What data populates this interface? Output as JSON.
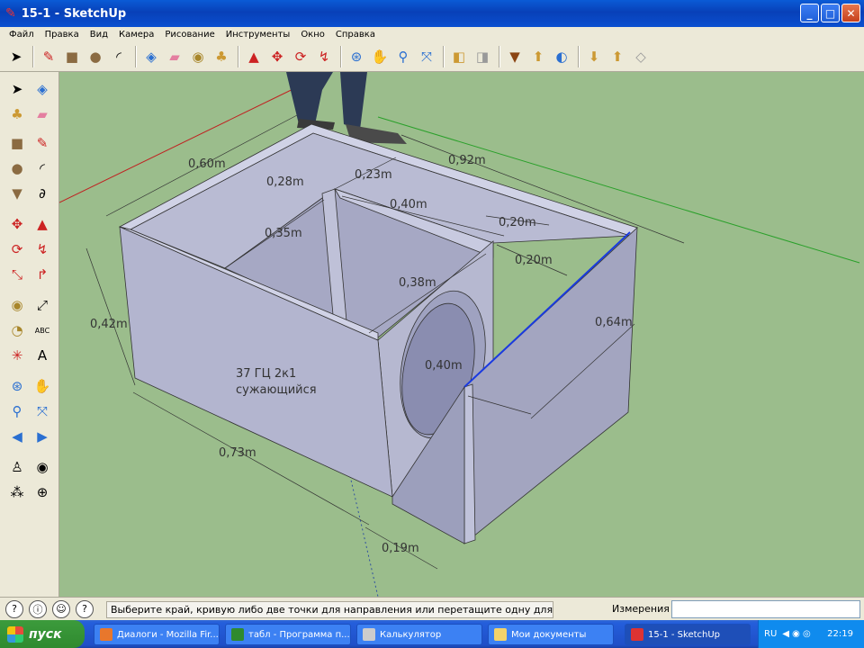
{
  "window": {
    "title": "15-1 - SketchUp",
    "minimize": "_",
    "maximize": "□",
    "close": "✕"
  },
  "menu": [
    "Файл",
    "Правка",
    "Вид",
    "Камера",
    "Рисование",
    "Инструменты",
    "Окно",
    "Справка"
  ],
  "toolbar_icons": [
    "select-icon",
    "pencil-icon",
    "rectangle-icon",
    "circle-icon",
    "arc-icon",
    "make-component-icon",
    "eraser-icon",
    "tape-measure-icon",
    "paint-bucket-icon",
    "push-pull-icon",
    "move-icon",
    "rotate-icon",
    "follow-me-icon",
    "orbit-icon",
    "pan-icon",
    "zoom-icon",
    "zoom-extents-icon",
    "previous-view-icon",
    "next-view-icon",
    "get-models-icon",
    "share-model-icon",
    "3d-warehouse-icon",
    "components-icon",
    "materials-icon",
    "styles-icon"
  ],
  "model": {
    "dimensions": [
      "0,60m",
      "0,28m",
      "0,23m",
      "0,92m",
      "0,40m",
      "0,20m",
      "0,35m",
      "0,20m",
      "0,38m",
      "0,64m",
      "0,42m",
      "0,40m",
      "0,73m",
      "0,19m"
    ],
    "label_line1": "37 ГЦ 2к1",
    "label_line2": "сужающийся"
  },
  "status": {
    "text": "Выберите край, кривую либо две точки для направления или перетащите одну для пер",
    "measurements_label": "Измерения",
    "measurements_value": ""
  },
  "taskbar": {
    "start": "пуск",
    "tasks": [
      "Диалоги - Mozilla Fir...",
      "табл - Программа п...",
      "Калькулятор",
      "Мои документы",
      "15-1 - SketchUp"
    ],
    "lang": "RU",
    "clock": "22:19"
  },
  "colors": {
    "ground": "#9bbd8c",
    "box_face": "#b3b5cf",
    "box_side": "#a3a5c0",
    "box_top": "#d0d2e6",
    "titlebar": "#0a4fd0",
    "taskbar": "#245edb"
  }
}
